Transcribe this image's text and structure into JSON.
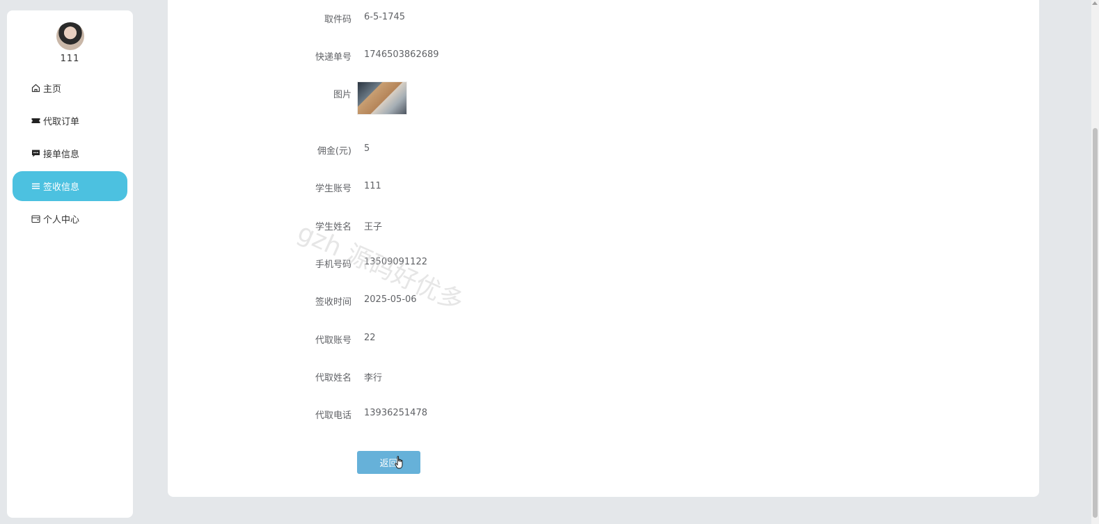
{
  "sidebar": {
    "username": "111",
    "items": [
      {
        "label": "主页",
        "icon": "home-icon"
      },
      {
        "label": "代取订单",
        "icon": "ticket-icon"
      },
      {
        "label": "接单信息",
        "icon": "message-icon"
      },
      {
        "label": "签收信息",
        "icon": "list-icon",
        "active": true
      },
      {
        "label": "个人中心",
        "icon": "wallet-icon"
      }
    ]
  },
  "detail": {
    "pickup_code": {
      "label": "取件码",
      "value": "6-5-1745"
    },
    "tracking_number": {
      "label": "快递单号",
      "value": "1746503862689"
    },
    "image": {
      "label": "图片"
    },
    "commission": {
      "label": "佣金(元)",
      "value": "5"
    },
    "student_account": {
      "label": "学生账号",
      "value": "111"
    },
    "student_name": {
      "label": "学生姓名",
      "value": "王子"
    },
    "phone": {
      "label": "手机号码",
      "value": "13509091122"
    },
    "sign_time": {
      "label": "签收时间",
      "value": "2025-05-06"
    },
    "courier_account": {
      "label": "代取账号",
      "value": "22"
    },
    "courier_name": {
      "label": "代取姓名",
      "value": "李行"
    },
    "courier_phone": {
      "label": "代取电话",
      "value": "13936251478"
    }
  },
  "buttons": {
    "back": "返回"
  },
  "watermark": "gzh 源码好优多",
  "colors": {
    "accent": "#4cc1e0",
    "button": "#66b1d9",
    "background": "#e4e7ea"
  }
}
